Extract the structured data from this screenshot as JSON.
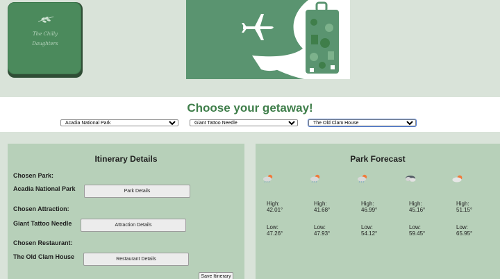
{
  "brand": {
    "logo_line1": "The Chilly",
    "logo_line2": "Daughters"
  },
  "header": {
    "title": "Choose your getaway!"
  },
  "selects": {
    "park": {
      "selected": "Acadia National Park"
    },
    "attraction": {
      "selected": "Giant Tattoo Needle"
    },
    "restaurant": {
      "selected": "The Old Clam House"
    }
  },
  "itinerary": {
    "title": "Itinerary Details",
    "park_label": "Chosen Park:",
    "park_value": "Acadia National Park",
    "park_button": "Park Details",
    "attraction_label": "Chosen Attraction:",
    "attraction_value": "Giant Tattoo Needle",
    "attraction_button": "Attraction Details",
    "restaurant_label": "Chosen Restaurant:",
    "restaurant_value": "The Old Clam House",
    "restaurant_button": "Restaurant Details",
    "save_button": "Save Itinerary"
  },
  "forecast": {
    "title": "Park Forecast",
    "high_label": "High:",
    "low_label": "Low:",
    "days": [
      {
        "icon": "rain-cloud-sun-icon",
        "high": "42.01°",
        "low": "47.26°"
      },
      {
        "icon": "rain-cloud-sun-icon",
        "high": "41.68°",
        "low": "47.93°"
      },
      {
        "icon": "rain-cloud-sun-icon",
        "high": "46.99°",
        "low": "54.12°"
      },
      {
        "icon": "dark-cloud-icon",
        "high": "45.16°",
        "low": "59.45°"
      },
      {
        "icon": "partly-cloudy-icon",
        "high": "51.15°",
        "low": "65.95°"
      }
    ]
  },
  "colors": {
    "page_bg": "#d9e3d9",
    "panel_bg": "#b7d0b9",
    "accent_green": "#3f7e4a",
    "logo_green": "#4b8a5c"
  }
}
